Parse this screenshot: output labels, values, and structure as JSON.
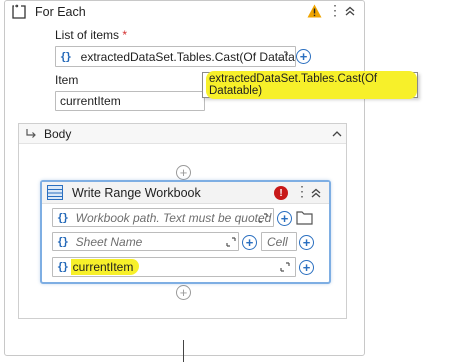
{
  "foreach": {
    "title": "For Each",
    "list_label": "List of items",
    "required_mark": "*",
    "list_value": "extractedDataSet.Tables.Cast(Of Datatable",
    "item_label": "Item",
    "item_value": "currentItem",
    "tooltip": "extractedDataSet.Tables.Cast(Of Datatable)"
  },
  "body": {
    "title": "Body"
  },
  "write_range": {
    "title": "Write Range Workbook",
    "error_icon": "!",
    "path_placeholder": "Workbook path. Text must be quoted",
    "sheet_placeholder": "Sheet Name",
    "cell_placeholder": "Cell",
    "data_value": "currentItem"
  },
  "brace_text": "{}",
  "icons": {
    "warning": "warning-icon",
    "kebab": "more-options-icon",
    "collapse": "collapse-icon",
    "expand": "expand-field-icon",
    "add": "add-icon",
    "folder": "folder-icon"
  },
  "colors": {
    "accent": "#2a6fc0",
    "highlight": "#f7f02a",
    "error": "#c81919",
    "warning": "#f0a500",
    "card_border_selected": "#7eaee3"
  }
}
